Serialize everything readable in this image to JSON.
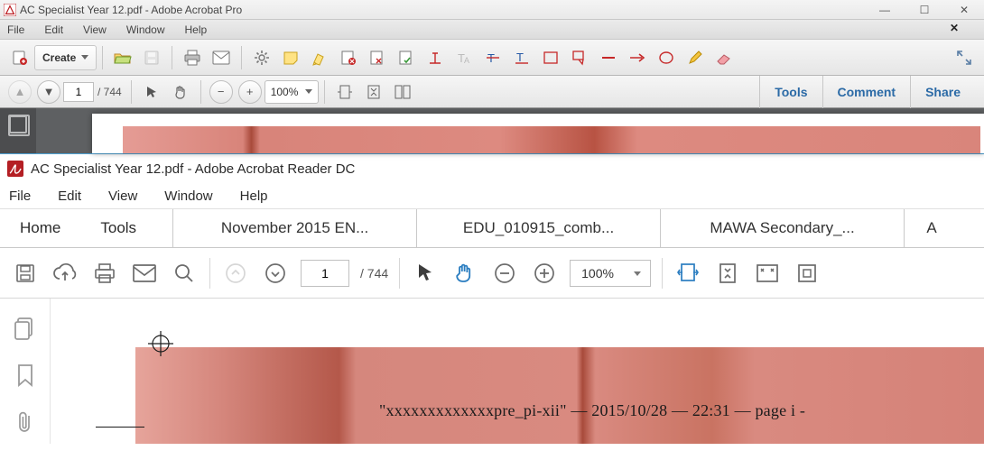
{
  "pro": {
    "title": "AC Specialist Year 12.pdf - Adobe Acrobat Pro",
    "menubar": {
      "file": "File",
      "edit": "Edit",
      "view": "View",
      "window": "Window",
      "help": "Help"
    },
    "create_label": "Create",
    "navbar": {
      "page": "1",
      "tot": "/ 744",
      "zoom": "100%",
      "tools": "Tools",
      "comment": "Comment",
      "share": "Share"
    }
  },
  "dc": {
    "title": "AC Specialist Year 12.pdf - Adobe Acrobat Reader DC",
    "menubar": {
      "file": "File",
      "edit": "Edit",
      "view": "View",
      "window": "Window",
      "help": "Help"
    },
    "tabs": {
      "home": "Home",
      "tools": "Tools",
      "t1": "November 2015 EN...",
      "t2": "EDU_010915_comb...",
      "t3": "MAWA Secondary_...",
      "t4": "A"
    },
    "toolbar": {
      "page": "1",
      "tot": "/ 744",
      "zoom": "100%"
    },
    "page_marker": "\"xxxxxxxxxxxxxpre_pi-xii\"  —  2015/10/28  —  22:31  —  page  i  -"
  }
}
